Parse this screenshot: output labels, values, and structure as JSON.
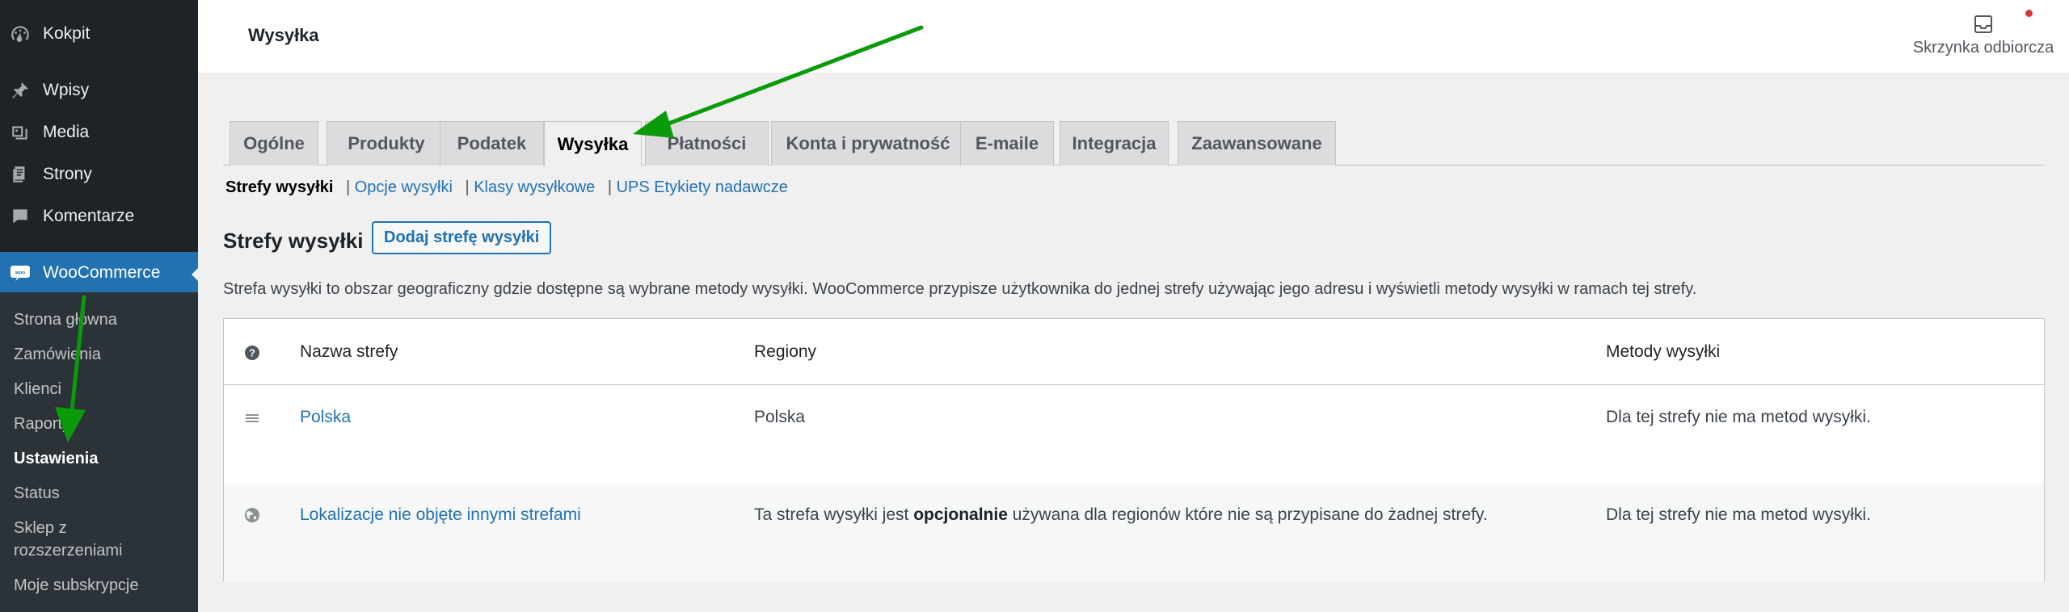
{
  "sidebar": {
    "items": [
      {
        "label": "Kokpit",
        "icon": "dashboard-icon"
      },
      {
        "label": "Wpisy",
        "icon": "pin-icon"
      },
      {
        "label": "Media",
        "icon": "media-icon"
      },
      {
        "label": "Strony",
        "icon": "pages-icon"
      },
      {
        "label": "Komentarze",
        "icon": "comments-icon"
      },
      {
        "label": "WooCommerce",
        "icon": "woo-icon"
      }
    ],
    "submenu": [
      "Strona główna",
      "Zamówienia",
      "Klienci",
      "Raporty",
      "Ustawienia",
      "Status",
      "Sklep z",
      "rozszerzeniami",
      "Moje subskrypcje"
    ]
  },
  "header": {
    "title": "Wysyłka",
    "inbox_label": "Skrzynka odbiorcza"
  },
  "tabs": [
    "Ogólne",
    "Produkty",
    "Podatek",
    "Wysyłka",
    "Płatności",
    "Konta i prywatność",
    "E-maile",
    "Integracja",
    "Zaawansowane"
  ],
  "subnav": {
    "current": "Strefy wysyłki",
    "links": [
      "Opcje wysyłki",
      "Klasy wysyłkowe",
      "UPS Etykiety nadawcze"
    ],
    "separator": "|"
  },
  "section": {
    "title": "Strefy wysyłki",
    "add_button": "Dodaj strefę wysyłki",
    "description": "Strefa wysyłki to obszar geograficzny gdzie dostępne są wybrane metody wysyłki. WooCommerce przypisze użytkownika do jednej strefy używając jego adresu i wyświetli metody wysyłki w ramach tej strefy."
  },
  "table": {
    "headers": {
      "name": "Nazwa strefy",
      "regions": "Regiony",
      "methods": "Metody wysyłki"
    },
    "rows": [
      {
        "name": "Polska",
        "regions": "Polska",
        "methods": "Dla tej strefy nie ma metod wysyłki."
      },
      {
        "name": "Lokalizacje nie objęte innymi strefami",
        "regions_pre": "Ta strefa wysyłki jest ",
        "regions_bold": "opcjonalnie",
        "regions_post": " używana dla regionów które nie są przypisane do żadnej strefy.",
        "methods": "Dla tej strefy nie ma metod wysyłki."
      }
    ]
  },
  "colors": {
    "accent": "#2271b1",
    "sidebar": "#1d2327",
    "annotation_arrow": "#0a9a0a"
  }
}
